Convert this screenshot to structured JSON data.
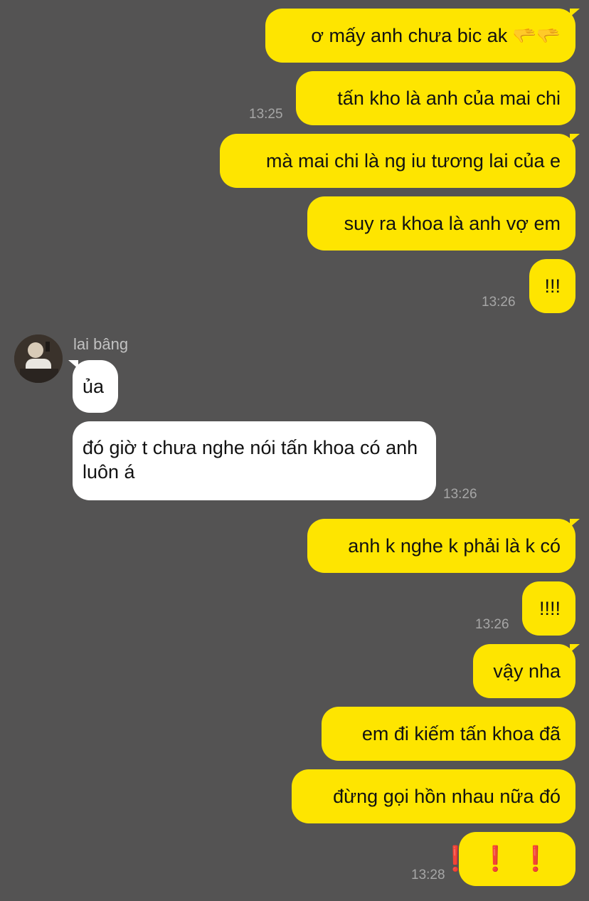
{
  "contact": {
    "name": "lai bâng"
  },
  "messages": [
    {
      "text": "ơ mấy anh chưa bic ak 🫳🫳"
    },
    {
      "text": "tấn kho là anh của mai chi",
      "time": "13:25"
    },
    {
      "text": "mà mai chi là ng iu tương lai của e"
    },
    {
      "text": "suy ra khoa là anh vợ em"
    },
    {
      "text": "!!!",
      "time": "13:26"
    },
    {
      "text": "ủa"
    },
    {
      "text": "đó giờ t chưa nghe nói tấn khoa có anh luôn á",
      "time": "13:26"
    },
    {
      "text": "anh k nghe k phải là k có"
    },
    {
      "text": "!!!!",
      "time": "13:26"
    },
    {
      "text": "vậy nha"
    },
    {
      "text": "em đi kiếm tấn khoa đã"
    },
    {
      "text": "đừng gọi hồn nhau nữa đó"
    },
    {
      "text": "❗❗❗",
      "time": "13:28"
    }
  ],
  "colors": {
    "outgoing": "#FEE500",
    "incoming": "#FFFFFF",
    "background": "#545353",
    "alert": "#E8101A"
  }
}
